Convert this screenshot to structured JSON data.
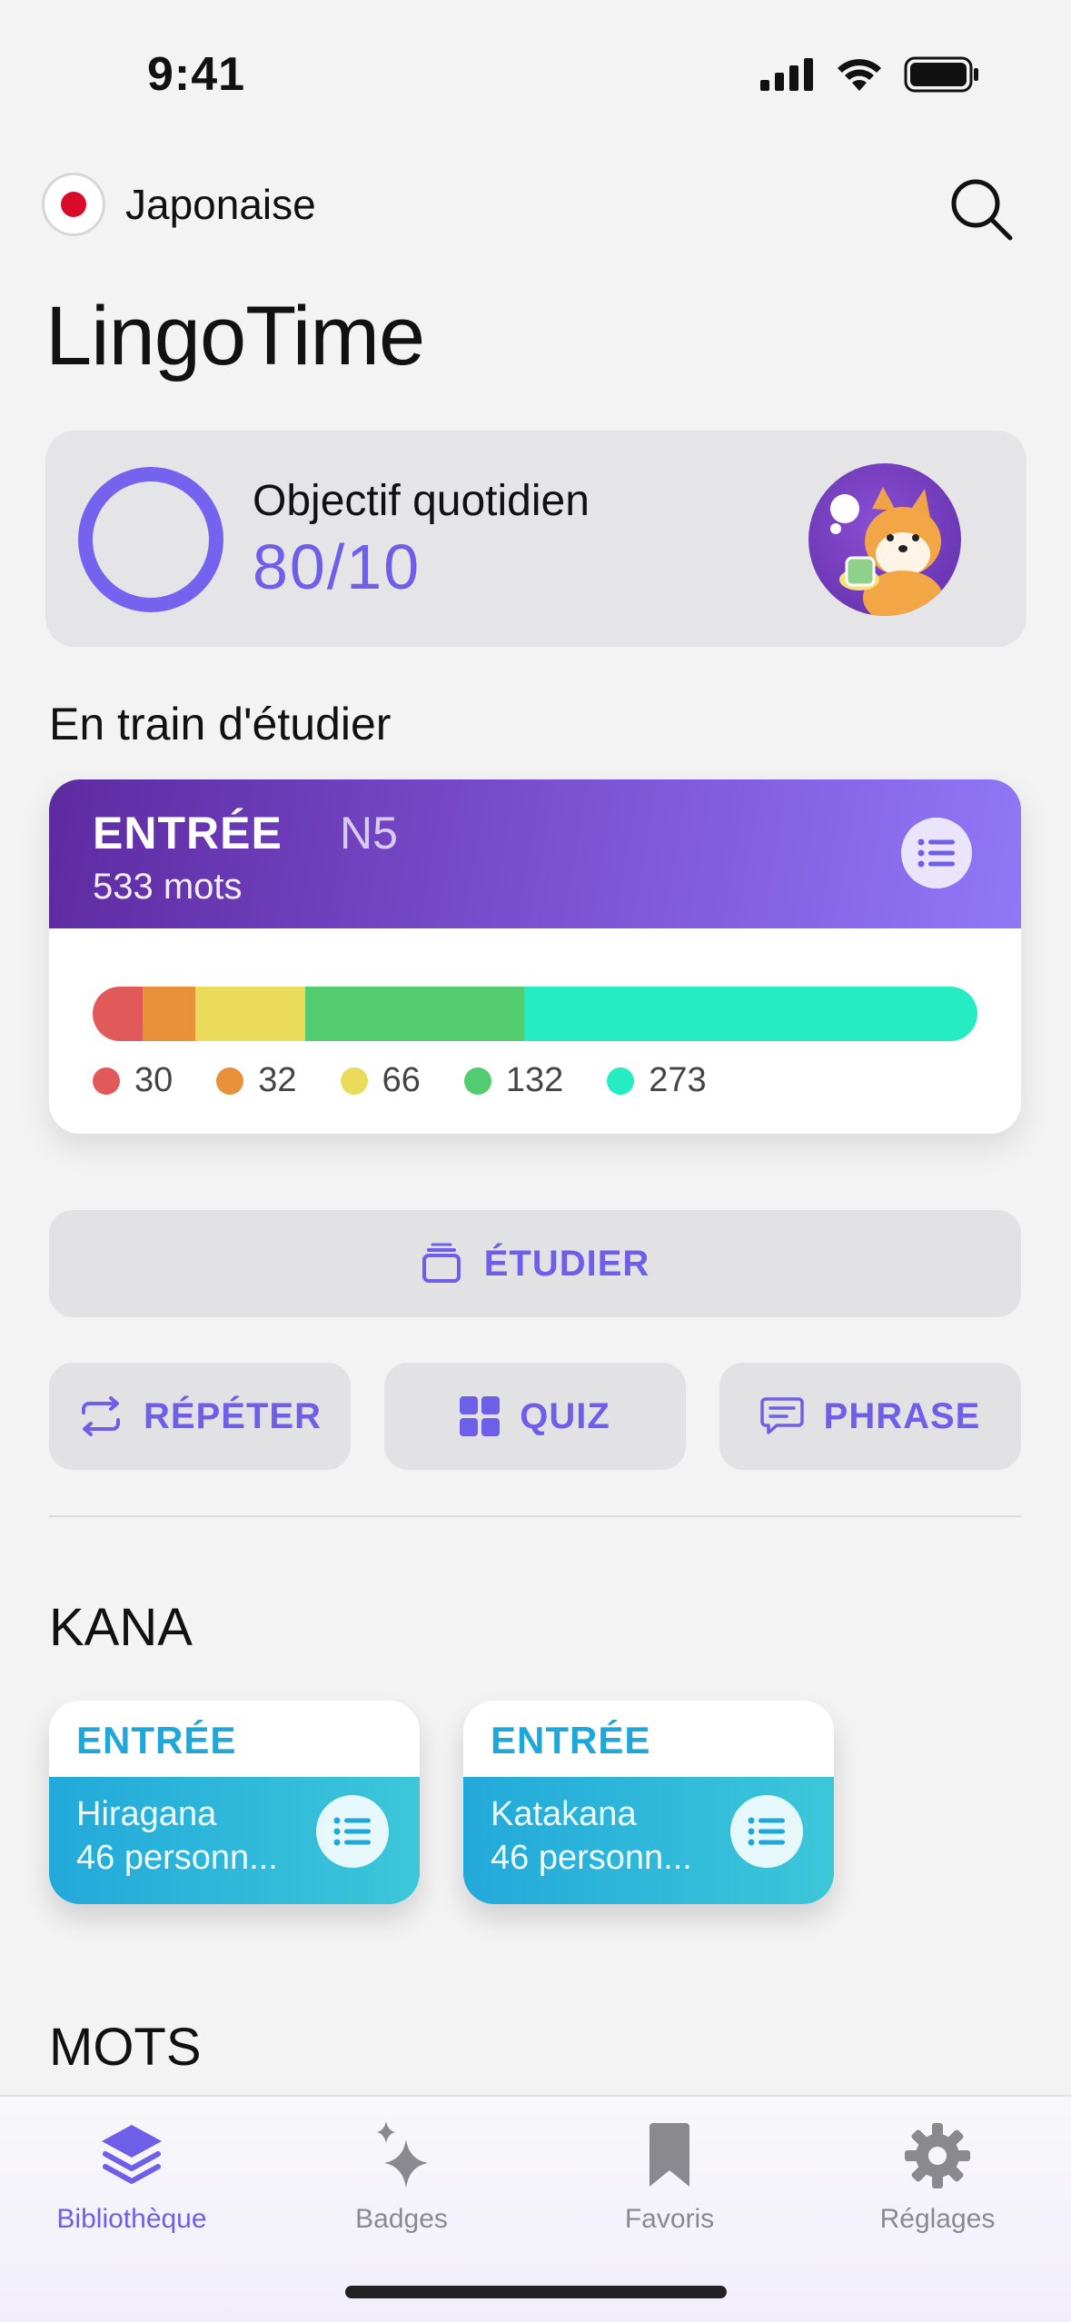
{
  "status_bar": {
    "time": "9:41"
  },
  "header": {
    "language": "Japonaise",
    "app_title": "LingoTime"
  },
  "goal": {
    "label": "Objectif quotidien",
    "value": "80/10"
  },
  "studying": {
    "section_title": "En train d'étudier",
    "level": "ENTRÉE",
    "sublevel": "N5",
    "word_count": "533 mots",
    "progress": [
      {
        "count": "30",
        "color": "#e05a5a"
      },
      {
        "count": "32",
        "color": "#e8903a"
      },
      {
        "count": "66",
        "color": "#eadb5a"
      },
      {
        "count": "132",
        "color": "#52cc6e"
      },
      {
        "count": "273",
        "color": "#26ecc4"
      }
    ]
  },
  "actions": {
    "study": "ÉTUDIER",
    "repeat": "RÉPÉTER",
    "quiz": "QUIZ",
    "phrase": "PHRASE"
  },
  "kana": {
    "section_title": "KANA",
    "cards": [
      {
        "level": "ENTRÉE",
        "name": "Hiragana",
        "count": "46 personn..."
      },
      {
        "level": "ENTRÉE",
        "name": "Katakana",
        "count": "46 personn..."
      }
    ]
  },
  "words": {
    "section_title": "MOTS"
  },
  "tab_bar": {
    "items": [
      {
        "label": "Bibliothèque",
        "icon": "stack-icon",
        "active": true
      },
      {
        "label": "Badges",
        "icon": "sparkles-icon",
        "active": false
      },
      {
        "label": "Favoris",
        "icon": "bookmark-icon",
        "active": false
      },
      {
        "label": "Réglages",
        "icon": "gear-icon",
        "active": false
      }
    ]
  },
  "colors": {
    "accent": "#6f5ee8",
    "kana_blue": "#1ea7d8"
  }
}
